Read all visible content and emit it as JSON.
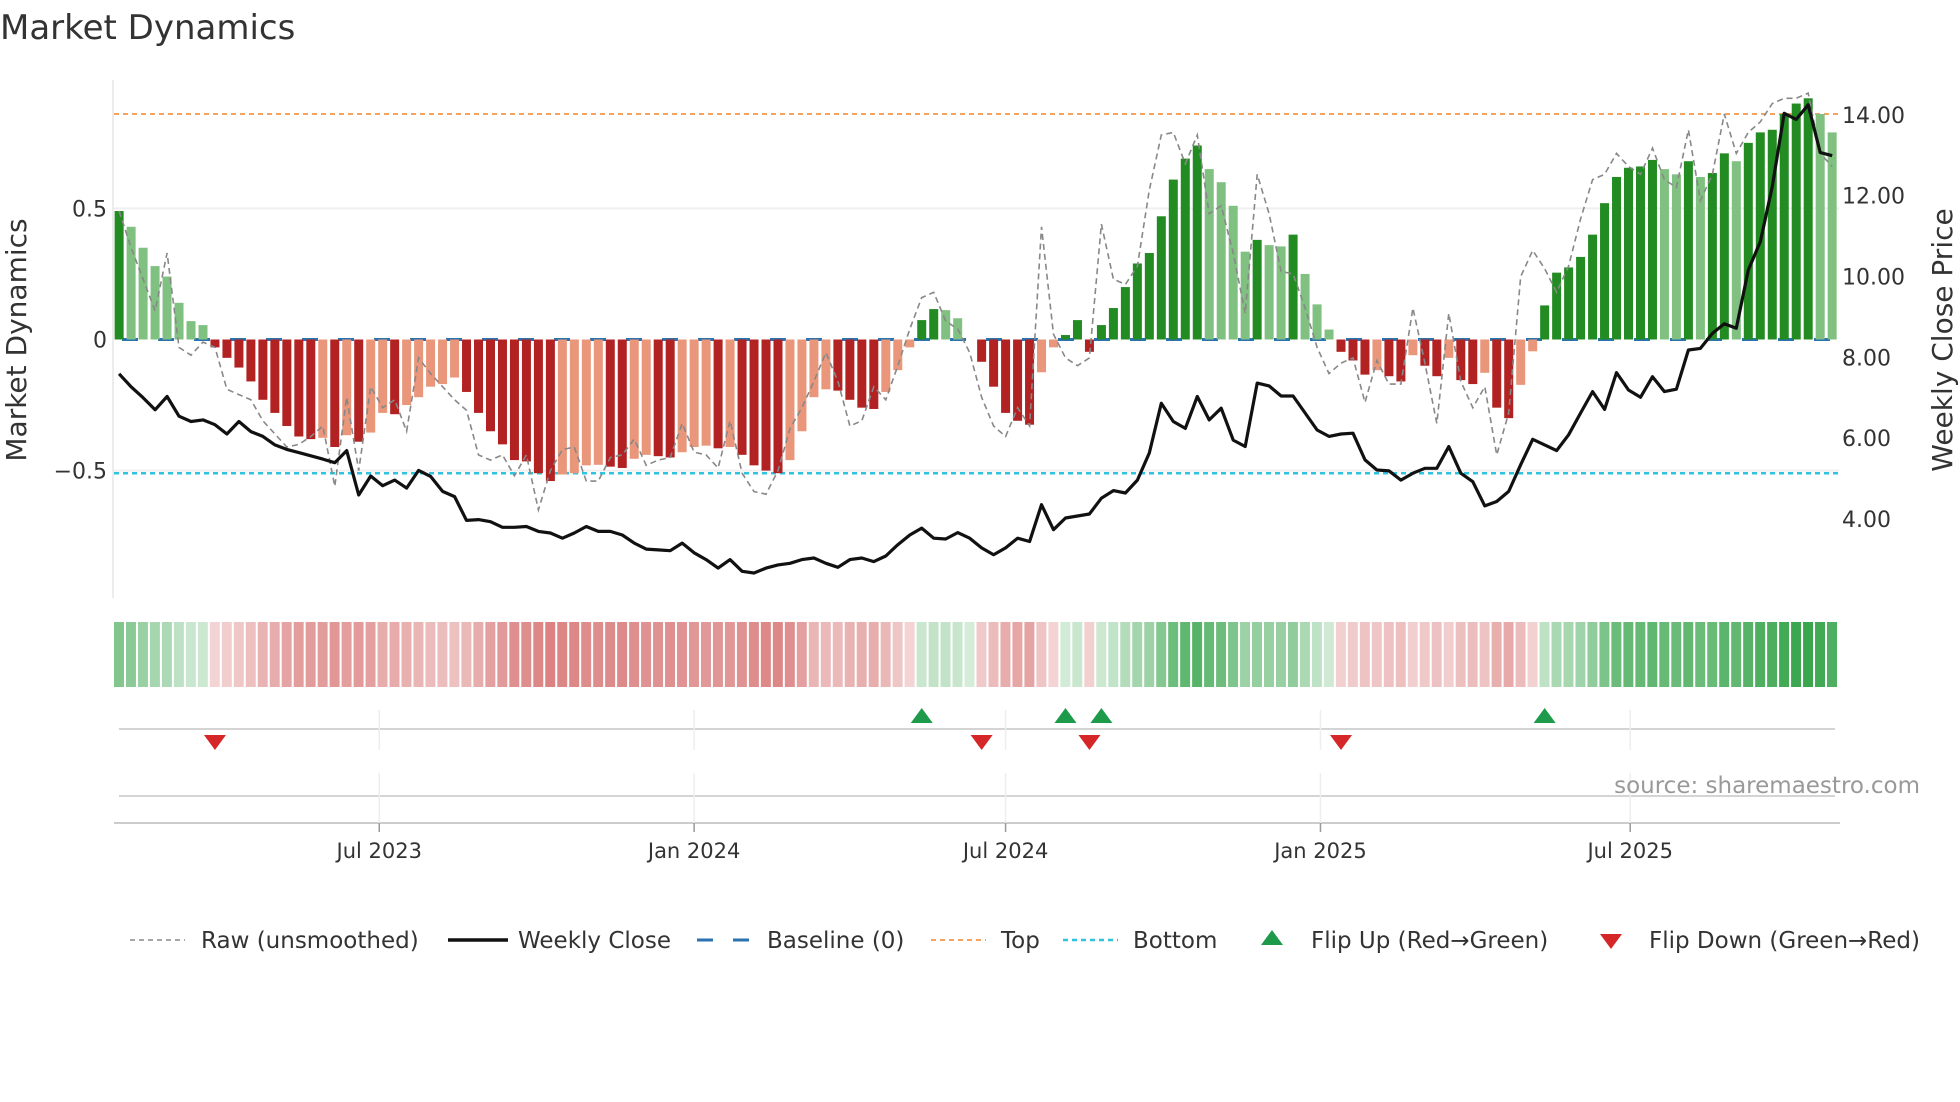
{
  "colors": {
    "bar_pos_strong": "#228b22",
    "bar_pos_weak": "#80c080",
    "bar_neg_strong": "#b22222",
    "bar_neg_weak": "#e9967a",
    "raw": "#888888",
    "close": "#111111",
    "baseline": "#2a72b0",
    "top": "#f4a460",
    "bottom": "#2ec4de",
    "flip_up": "#1e9b4a",
    "flip_down": "#d62728",
    "heat_pos": "#2ea043",
    "heat_neg": "#c83c3c"
  },
  "chart_data": {
    "type": "bar",
    "title": "Market Dynamics",
    "ylabel": "Market Dynamics",
    "y2label": "Weekly Close Price",
    "source": "source: sharemaestro.com",
    "frequency": "weekly",
    "start_date": "2023-01-30",
    "xlim": [
      "2023-01-27",
      "2025-10-31"
    ],
    "ylim": [
      -0.986,
      0.986
    ],
    "y2lim": [
      2.04,
      14.84
    ],
    "yticks": [
      {
        "v": 0.5,
        "label": "0.5"
      },
      {
        "v": 0,
        "label": "0"
      },
      {
        "v": -0.5,
        "label": "−0.5"
      }
    ],
    "y2ticks": [
      {
        "v": 14,
        "label": "14.00"
      },
      {
        "v": 12,
        "label": "12.00"
      },
      {
        "v": 10,
        "label": "10.00"
      },
      {
        "v": 8,
        "label": "8.00"
      },
      {
        "v": 6,
        "label": "6.00"
      },
      {
        "v": 4,
        "label": "4.00"
      }
    ],
    "xticks": [
      {
        "date": "2023-07-01",
        "label": "Jul 2023"
      },
      {
        "date": "2024-01-01",
        "label": "Jan 2024"
      },
      {
        "date": "2024-07-01",
        "label": "Jul 2024"
      },
      {
        "date": "2025-01-01",
        "label": "Jan 2025"
      },
      {
        "date": "2025-07-01",
        "label": "Jul 2025"
      }
    ],
    "baseline": 0,
    "top": 0.86,
    "bottom": -0.51,
    "grid": true,
    "legend_placement": "bottom",
    "legend": [
      {
        "key": "raw",
        "label": "Raw (unsmoothed)"
      },
      {
        "key": "close",
        "label": "Weekly Close"
      },
      {
        "key": "baseline",
        "label": "Baseline (0)"
      },
      {
        "key": "top",
        "label": "Top"
      },
      {
        "key": "bottom",
        "label": "Bottom"
      },
      {
        "key": "flip_up",
        "label": "Flip Up (Red→Green)"
      },
      {
        "key": "flip_down",
        "label": "Flip Down (Green→Red)"
      }
    ],
    "series": [
      {
        "name": "Market Dynamics",
        "type": "bar",
        "values": [
          0.49,
          0.43,
          0.35,
          0.28,
          0.24,
          0.14,
          0.07,
          0.055,
          -0.03,
          -0.07,
          -0.107,
          -0.16,
          -0.23,
          -0.28,
          -0.33,
          -0.37,
          -0.38,
          -0.375,
          -0.41,
          -0.365,
          -0.39,
          -0.355,
          -0.28,
          -0.285,
          -0.25,
          -0.22,
          -0.18,
          -0.17,
          -0.145,
          -0.2,
          -0.28,
          -0.35,
          -0.4,
          -0.46,
          -0.465,
          -0.51,
          -0.54,
          -0.515,
          -0.51,
          -0.48,
          -0.478,
          -0.485,
          -0.49,
          -0.455,
          -0.44,
          -0.445,
          -0.45,
          -0.43,
          -0.41,
          -0.405,
          -0.415,
          -0.41,
          -0.44,
          -0.48,
          -0.5,
          -0.51,
          -0.46,
          -0.35,
          -0.22,
          -0.19,
          -0.195,
          -0.23,
          -0.26,
          -0.265,
          -0.2,
          -0.117,
          -0.03,
          0.074,
          0.116,
          0.112,
          0.081,
          0.0,
          -0.085,
          -0.18,
          -0.28,
          -0.31,
          -0.325,
          -0.125,
          -0.03,
          0.017,
          0.074,
          -0.047,
          0.055,
          0.12,
          0.2,
          0.29,
          0.33,
          0.47,
          0.61,
          0.69,
          0.74,
          0.65,
          0.6,
          0.51,
          0.335,
          0.38,
          0.36,
          0.355,
          0.4,
          0.25,
          0.134,
          0.038,
          -0.047,
          -0.08,
          -0.134,
          -0.117,
          -0.14,
          -0.16,
          -0.06,
          -0.1,
          -0.14,
          -0.07,
          -0.155,
          -0.17,
          -0.127,
          -0.26,
          -0.3,
          -0.173,
          -0.045,
          0.13,
          0.255,
          0.275,
          0.315,
          0.4,
          0.52,
          0.62,
          0.655,
          0.66,
          0.685,
          0.65,
          0.63,
          0.68,
          0.62,
          0.635,
          0.71,
          0.68,
          0.75,
          0.79,
          0.8,
          0.86,
          0.9,
          0.92,
          0.86,
          0.79
        ]
      },
      {
        "name": "Raw (unsmoothed)",
        "type": "line",
        "values": [
          0.49,
          0.35,
          0.23,
          0.11,
          0.33,
          -0.03,
          -0.06,
          -0.01,
          -0.03,
          -0.19,
          -0.21,
          -0.23,
          -0.31,
          -0.36,
          -0.41,
          -0.4,
          -0.37,
          -0.33,
          -0.56,
          -0.22,
          -0.5,
          -0.18,
          -0.26,
          -0.23,
          -0.35,
          -0.07,
          -0.13,
          -0.18,
          -0.23,
          -0.27,
          -0.44,
          -0.46,
          -0.44,
          -0.52,
          -0.44,
          -0.65,
          -0.5,
          -0.42,
          -0.41,
          -0.54,
          -0.54,
          -0.45,
          -0.44,
          -0.38,
          -0.48,
          -0.46,
          -0.45,
          -0.32,
          -0.43,
          -0.44,
          -0.49,
          -0.31,
          -0.51,
          -0.58,
          -0.59,
          -0.5,
          -0.34,
          -0.26,
          -0.16,
          -0.05,
          -0.16,
          -0.33,
          -0.31,
          -0.18,
          -0.23,
          -0.1,
          0.04,
          0.16,
          0.18,
          0.07,
          0.04,
          -0.05,
          -0.22,
          -0.33,
          -0.37,
          -0.26,
          -0.33,
          0.43,
          0.02,
          -0.07,
          -0.1,
          -0.07,
          0.44,
          0.23,
          0.21,
          0.28,
          0.57,
          0.78,
          0.79,
          0.67,
          0.78,
          0.48,
          0.51,
          0.33,
          0.1,
          0.63,
          0.48,
          0.26,
          0.25,
          0.12,
          -0.03,
          -0.13,
          -0.09,
          -0.07,
          -0.24,
          -0.08,
          -0.17,
          -0.17,
          0.12,
          -0.09,
          -0.32,
          0.1,
          -0.16,
          -0.26,
          -0.18,
          -0.44,
          -0.28,
          0.24,
          0.34,
          0.27,
          0.18,
          0.28,
          0.46,
          0.61,
          0.63,
          0.71,
          0.66,
          0.63,
          0.73,
          0.61,
          0.58,
          0.8,
          0.53,
          0.63,
          0.86,
          0.71,
          0.79,
          0.83,
          0.9,
          0.92,
          0.92,
          0.94,
          0.71,
          0.66
        ]
      },
      {
        "name": "Weekly Close",
        "type": "line",
        "axis": "right",
        "values": [
          7.59,
          7.27,
          7.0,
          6.7,
          7.03,
          6.54,
          6.41,
          6.45,
          6.33,
          6.1,
          6.41,
          6.16,
          6.04,
          5.83,
          5.72,
          5.64,
          5.56,
          5.48,
          5.39,
          5.69,
          4.59,
          5.06,
          4.82,
          4.96,
          4.76,
          5.2,
          5.05,
          4.68,
          4.55,
          3.96,
          3.98,
          3.93,
          3.79,
          3.79,
          3.81,
          3.69,
          3.65,
          3.52,
          3.65,
          3.81,
          3.69,
          3.69,
          3.6,
          3.4,
          3.25,
          3.23,
          3.21,
          3.4,
          3.16,
          2.99,
          2.78,
          2.99,
          2.7,
          2.66,
          2.78,
          2.86,
          2.9,
          2.99,
          3.03,
          2.9,
          2.8,
          2.99,
          3.03,
          2.94,
          3.08,
          3.36,
          3.6,
          3.77,
          3.52,
          3.5,
          3.66,
          3.52,
          3.28,
          3.11,
          3.28,
          3.52,
          3.44,
          4.35,
          3.73,
          4.02,
          4.07,
          4.12,
          4.51,
          4.7,
          4.64,
          4.96,
          5.63,
          6.86,
          6.41,
          6.24,
          7.03,
          6.45,
          6.74,
          5.95,
          5.79,
          7.36,
          7.29,
          7.04,
          7.04,
          6.62,
          6.2,
          6.04,
          6.1,
          6.12,
          5.46,
          5.21,
          5.19,
          4.96,
          5.13,
          5.25,
          5.25,
          5.79,
          5.13,
          4.92,
          4.32,
          4.43,
          4.68,
          5.34,
          5.97,
          5.83,
          5.69,
          6.08,
          6.62,
          7.15,
          6.71,
          7.62,
          7.19,
          7.01,
          7.52,
          7.15,
          7.21,
          8.18,
          8.22,
          8.59,
          8.83,
          8.72,
          10.16,
          10.86,
          12.23,
          14.04,
          13.89,
          14.25,
          13.07,
          12.99
        ]
      }
    ],
    "flips": {
      "up_week_index": [
        67,
        79,
        82,
        119
      ],
      "down_week_index": [
        8,
        72,
        81,
        102
      ]
    }
  }
}
